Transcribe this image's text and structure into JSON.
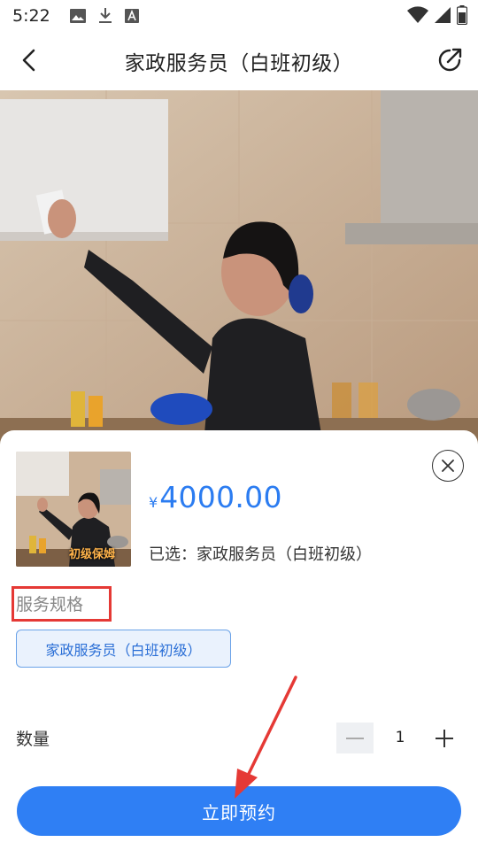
{
  "status_bar": {
    "time": "5:22",
    "left_icons": [
      "image-icon",
      "download-icon",
      "text-a-icon"
    ],
    "right_icons": [
      "wifi-icon",
      "signal-icon",
      "battery-icon"
    ]
  },
  "header": {
    "title": "家政服务员（白班初级）",
    "back_icon": "chevron-left-icon",
    "share_icon": "share-icon"
  },
  "sheet": {
    "thumbnail_caption": "初级保姆",
    "price": {
      "currency": "¥",
      "amount": "4000.00",
      "color": "#2b7cf1"
    },
    "selected_text": "已选：家政服务员（白班初级）",
    "close_icon": "close-circle-icon",
    "spec": {
      "title": "服务规格",
      "options": [
        "家政服务员（白班初级）"
      ],
      "selected_index": 0
    },
    "quantity": {
      "label": "数量",
      "value": "1"
    },
    "book_button": "立即预约",
    "accent_color": "#2f7ff4",
    "highlight_color": "#e53935"
  }
}
